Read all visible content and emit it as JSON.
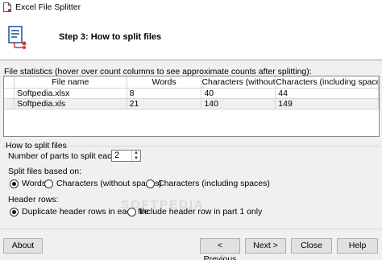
{
  "window": {
    "title": "Excel File Splitter"
  },
  "header": {
    "step_title": "Step 3: How to split files"
  },
  "stats": {
    "label": "File statistics (hover over count columns to see approximate counts after splitting):",
    "columns": [
      "File name",
      "Words",
      "Characters (without s...",
      "Characters (including spaces)"
    ],
    "rows": [
      {
        "file": "Softpedia.xlsx",
        "words": "8",
        "chars_no_spaces": "40",
        "chars_spaces": "44"
      },
      {
        "file": "Softpedia.xls",
        "words": "21",
        "chars_no_spaces": "140",
        "chars_spaces": "149"
      }
    ]
  },
  "split": {
    "group_title": "How to split files",
    "parts_label": "Number of parts to split each file:",
    "parts_value": "2",
    "based_on_label": "Split files based on:",
    "based_on_options": [
      "Words",
      "Characters (without spaces)",
      "Characters (including spaces)"
    ],
    "based_on_selected": "Words",
    "header_rows_label": "Header rows:",
    "header_rows_options": [
      "Duplicate header rows in each file",
      "Include header row in part 1 only"
    ],
    "header_rows_selected": "Duplicate header rows in each file"
  },
  "buttons": {
    "about": "About",
    "previous": "< Previous",
    "next": "Next >",
    "close": "Close",
    "help": "Help"
  },
  "watermark": "SOFTPEDIA",
  "colors": {
    "window_bg": "#f0f0f0",
    "button_bg": "#e1e1e1",
    "icon_red": "#d9342b",
    "icon_blue": "#1f4e9c"
  }
}
